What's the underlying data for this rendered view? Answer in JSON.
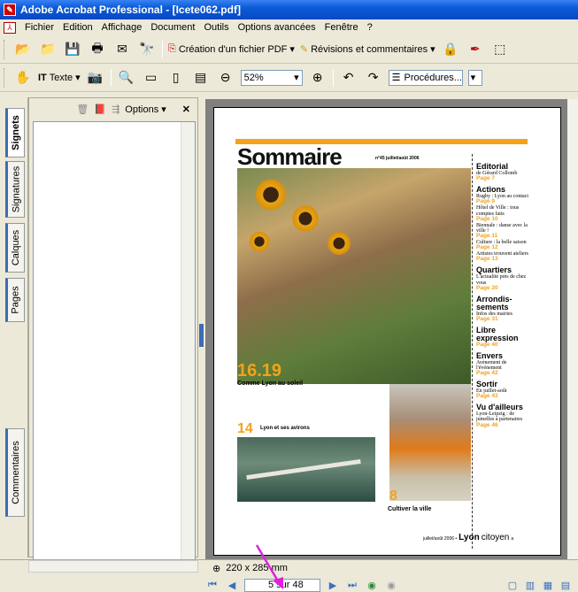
{
  "window": {
    "title": "Adobe Acrobat Professional - [Icete062.pdf]"
  },
  "menu": [
    "Fichier",
    "Edition",
    "Affichage",
    "Document",
    "Outils",
    "Options avancées",
    "Fenêtre",
    "?"
  ],
  "toolbar1": {
    "create_pdf": "Création d'un fichier PDF",
    "review": "Révisions et commentaires"
  },
  "toolbar2": {
    "text_tool": "Texte",
    "zoom": "52%",
    "procedures": "Procédures...",
    "help": "?"
  },
  "side_tabs": [
    "Signets",
    "Signatures",
    "Calques",
    "Pages",
    "Commentaires"
  ],
  "nav_panel": {
    "options": "Options"
  },
  "status": {
    "page_size": "220 x 285 mm",
    "page_counter": "5 sur 48"
  },
  "page": {
    "title": "Sommaire",
    "issue": "n°45 juillet/août 2006",
    "feature1_num": "16.19",
    "feature1_caption": "Comme Lyon au soleil",
    "feature2_num": "14",
    "feature2_caption": "Lyon et ses avirons",
    "feature3_num": "8",
    "feature3_caption": "Cultiver la ville",
    "footer_date": "juillet/août 2006 •",
    "footer_brand_bold": "Lyon",
    "footer_brand": "citoyen",
    "footer_page": "a",
    "sections": [
      {
        "head": "Editorial",
        "items": [
          {
            "text": "de Gérard Collomb",
            "page": "Page 7"
          }
        ]
      },
      {
        "head": "Actions",
        "items": [
          {
            "text": "Rugby : Lyon au contact",
            "page": "Page 9"
          },
          {
            "text": "Hôtel de Ville : tous comptes faits",
            "page": "Page 10"
          },
          {
            "text": "Biennale : danse avec la ville !",
            "page": "Page 11"
          },
          {
            "text": "Culture : la belle saison",
            "page": "Page 12"
          },
          {
            "text": "Artistes trouvent ateliers",
            "page": "Page 13"
          }
        ]
      },
      {
        "head": "Quartiers",
        "items": [
          {
            "text": "L'actualité près de chez vous",
            "page": "Page 20"
          }
        ]
      },
      {
        "head": "Arrondis-sements",
        "items": [
          {
            "text": "Infos des mairies",
            "page": "Page 31"
          }
        ]
      },
      {
        "head": "Libre expression",
        "items": [
          {
            "text": "",
            "page": "Page 40"
          }
        ]
      },
      {
        "head": "Envers",
        "items": [
          {
            "text": "Avènement de l'événement",
            "page": "Page 42"
          }
        ]
      },
      {
        "head": "Sortir",
        "items": [
          {
            "text": "En juillet-août",
            "page": "Page 43"
          }
        ]
      },
      {
        "head": "Vu d'ailleurs",
        "items": [
          {
            "text": "Lyon-Leipzig : de jumelles à partenaires",
            "page": "Page 46"
          }
        ]
      }
    ]
  },
  "colors": {
    "accent_orange": "#f4a21a",
    "titlebar_blue": "#0A5BD7",
    "arrow_magenta": "#e020e0"
  }
}
